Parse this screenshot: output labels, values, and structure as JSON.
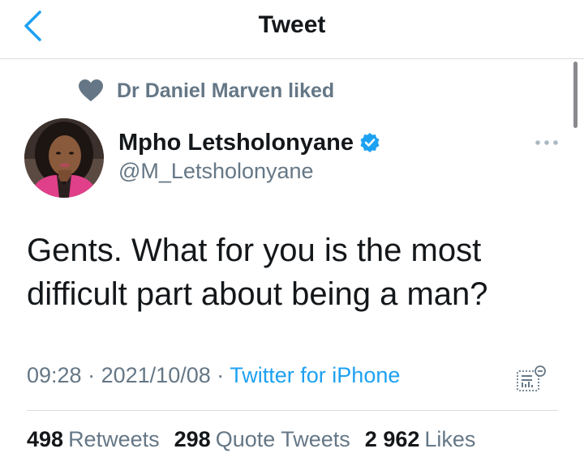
{
  "nav": {
    "title": "Tweet",
    "back_icon": "chevron-left-icon",
    "accent_color": "#1da1f2"
  },
  "social_context": {
    "icon": "heart-icon",
    "text": "Dr Daniel Marven liked"
  },
  "author": {
    "display_name": "Mpho Letsholonyane",
    "verified": true,
    "handle": "@M_Letsholonyane"
  },
  "tweet": {
    "text": "Gents. What for you is the most difficult part about being a man?"
  },
  "meta": {
    "time": "09:28",
    "separator": "·",
    "date": "2021/10/08",
    "source": "Twitter for iPhone",
    "analytics_icon": "analytics-icon"
  },
  "stats": {
    "retweets_count": "498",
    "retweets_label": "Retweets",
    "quotes_count": "298",
    "quotes_label": "Quote Tweets",
    "likes_count": "2 962",
    "likes_label": "Likes"
  },
  "colors": {
    "primary_text": "#14171a",
    "secondary_text": "#657786",
    "link": "#1da1f2",
    "divider": "#d9dde1"
  }
}
